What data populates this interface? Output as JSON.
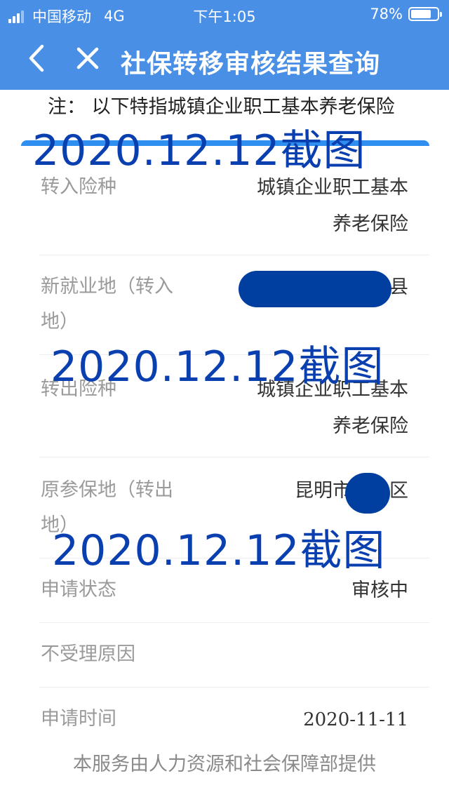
{
  "status_bar": {
    "carrier": "中国移动",
    "network": "4G",
    "time": "下午1:05",
    "battery": "78%",
    "battery_level": 0.78,
    "signal_icon": "signal-bars-icon",
    "battery_icon": "battery-icon"
  },
  "nav": {
    "title": "社保转移审核结果查询",
    "back_icon": "chevron-left-icon",
    "close_icon": "close-icon"
  },
  "note": "注： 以下特指城镇企业职工基本养老保险",
  "rows": [
    {
      "label": "转入险种",
      "value_lines": [
        "城镇企业职工基本",
        "养老保险"
      ]
    },
    {
      "label_lines": [
        "新就业地（转入",
        "地）"
      ],
      "value": "县"
    },
    {
      "label": "转出险种",
      "value_lines": [
        "城镇企业职工基本",
        "养老保险"
      ]
    },
    {
      "label_lines": [
        "原参保地（转出",
        "地）"
      ],
      "value_prefix": "昆明市",
      "value_suffix": "区"
    },
    {
      "label": "申请状态",
      "value": "审核中"
    },
    {
      "label": "不受理原因",
      "value": ""
    },
    {
      "label": "申请时间",
      "value": "2020-11-11"
    }
  ],
  "watermark": "2020.12.12截图",
  "footer": "本服务由人力资源和社会保障部提供",
  "colors": {
    "header_bg": "#4a8fe6",
    "card_accent": "#2f8ff0",
    "watermark": "#0a3fb0",
    "redaction": "#003f9f"
  }
}
